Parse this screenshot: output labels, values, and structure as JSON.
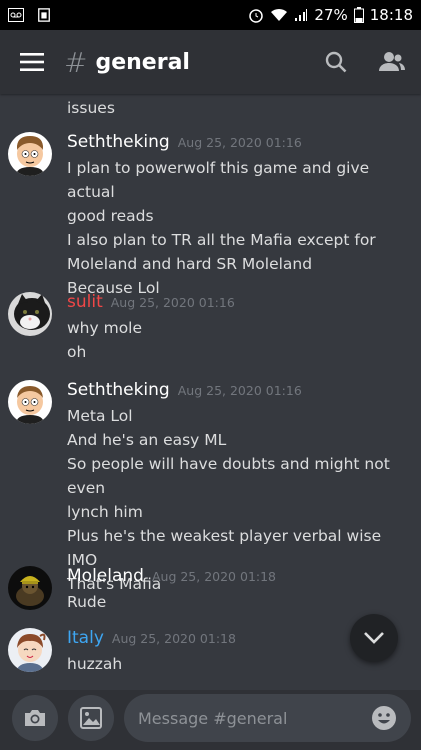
{
  "statusbar": {
    "battery": "27%",
    "time": "18:18"
  },
  "header": {
    "hash": "#",
    "channel": "general"
  },
  "colors": {
    "sulit": "#f04747",
    "italy": "#3ea6f2",
    "default_author": "#ffffff"
  },
  "messages": {
    "top_continuation": "issues",
    "groups": [
      {
        "author": "Seththeking",
        "timestamp": "Aug 25, 2020 01:16",
        "lines": [
          "I plan to powerwolf this game and give actual",
          "good reads",
          "I also plan to TR all the Mafia except for",
          "Moleland and hard SR Moleland",
          "Because Lol"
        ]
      },
      {
        "author": "sulit",
        "timestamp": "Aug 25, 2020 01:16",
        "lines": [
          "why mole",
          "oh"
        ]
      },
      {
        "author": "Seththeking",
        "timestamp": "Aug 25, 2020 01:16",
        "lines": [
          "Meta Lol",
          "And he's an easy ML",
          "So people will have doubts and might not even",
          "lynch him",
          "Plus he's the weakest player verbal wise IMO",
          "That's Mafia"
        ]
      },
      {
        "author": "Moleland",
        "timestamp": "Aug 25, 2020 01:18",
        "lines": [
          "Rude"
        ]
      },
      {
        "author": "Italy",
        "timestamp": "Aug 25, 2020 01:18",
        "lines": [
          "huzzah"
        ]
      }
    ]
  },
  "composer": {
    "placeholder": "Message #general"
  }
}
